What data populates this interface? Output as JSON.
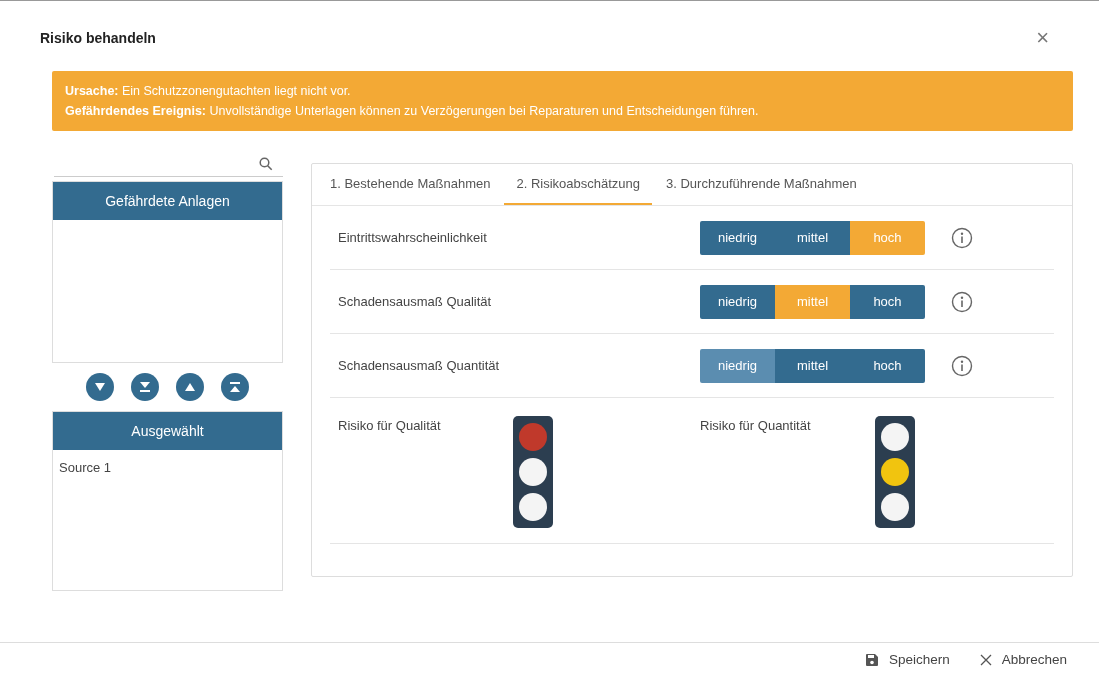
{
  "dialog": {
    "title": "Risiko behandeln",
    "close": "×"
  },
  "banner": {
    "lines": [
      "**Ursache:** Ein Schutzzonengutachten liegt nicht vor.",
      "**Gefährdendes Ereignis:** Unvollständige Unterlagen können zu Verzögerungen bei Reparaturen und Entscheidungen führen."
    ]
  },
  "left": {
    "available": {
      "header": "Gefährdete Anlagen"
    },
    "move_buttons": [
      {
        "kind": "down"
      },
      {
        "kind": "bottom"
      },
      {
        "kind": "up"
      },
      {
        "kind": "top"
      }
    ],
    "selected_list": {
      "header": "Ausgewählt",
      "items": [
        "Source 1"
      ]
    }
  },
  "tabs": [
    {
      "label": "1. Bestehende Maßnahmen",
      "selected": false
    },
    {
      "label": "2. Risikoabschätzung",
      "selected": true
    },
    {
      "label": "3. Durchzuführende Maßnahmen",
      "selected": false
    }
  ],
  "ratings": [
    {
      "label": "Eintrittswahrscheinlichkeit",
      "options": [
        {
          "label": "niedrig",
          "selected": false,
          "hovered": false
        },
        {
          "label": "mittel",
          "selected": false,
          "hovered": false
        },
        {
          "label": "hoch",
          "selected": true,
          "hovered": false
        }
      ]
    },
    {
      "label": "Schadensausmaß Qualität",
      "options": [
        {
          "label": "niedrig",
          "selected": false,
          "hovered": false
        },
        {
          "label": "mittel",
          "selected": true,
          "hovered": false
        },
        {
          "label": "hoch",
          "selected": false,
          "hovered": false
        }
      ]
    },
    {
      "label": "Schadensausmaß Quantität",
      "options": [
        {
          "label": "niedrig",
          "selected": false,
          "hovered": true
        },
        {
          "label": "mittel",
          "selected": false,
          "hovered": false
        },
        {
          "label": "hoch",
          "selected": false,
          "hovered": false
        }
      ]
    }
  ],
  "risks": [
    {
      "label": "Risiko für Qualität",
      "lights": [
        {
          "color": "#c0392b"
        },
        {
          "color": "#f4f4f4"
        },
        {
          "color": "#f4f4f4"
        }
      ]
    },
    {
      "label": "Risiko für Quantität",
      "lights": [
        {
          "color": "#f4f4f4"
        },
        {
          "color": "#f1c40f"
        },
        {
          "color": "#f4f4f4"
        }
      ]
    }
  ],
  "footer": {
    "buttons": [
      {
        "kind": "save",
        "label": "Speichern"
      },
      {
        "kind": "cancel",
        "label": "Abbrechen"
      }
    ]
  }
}
